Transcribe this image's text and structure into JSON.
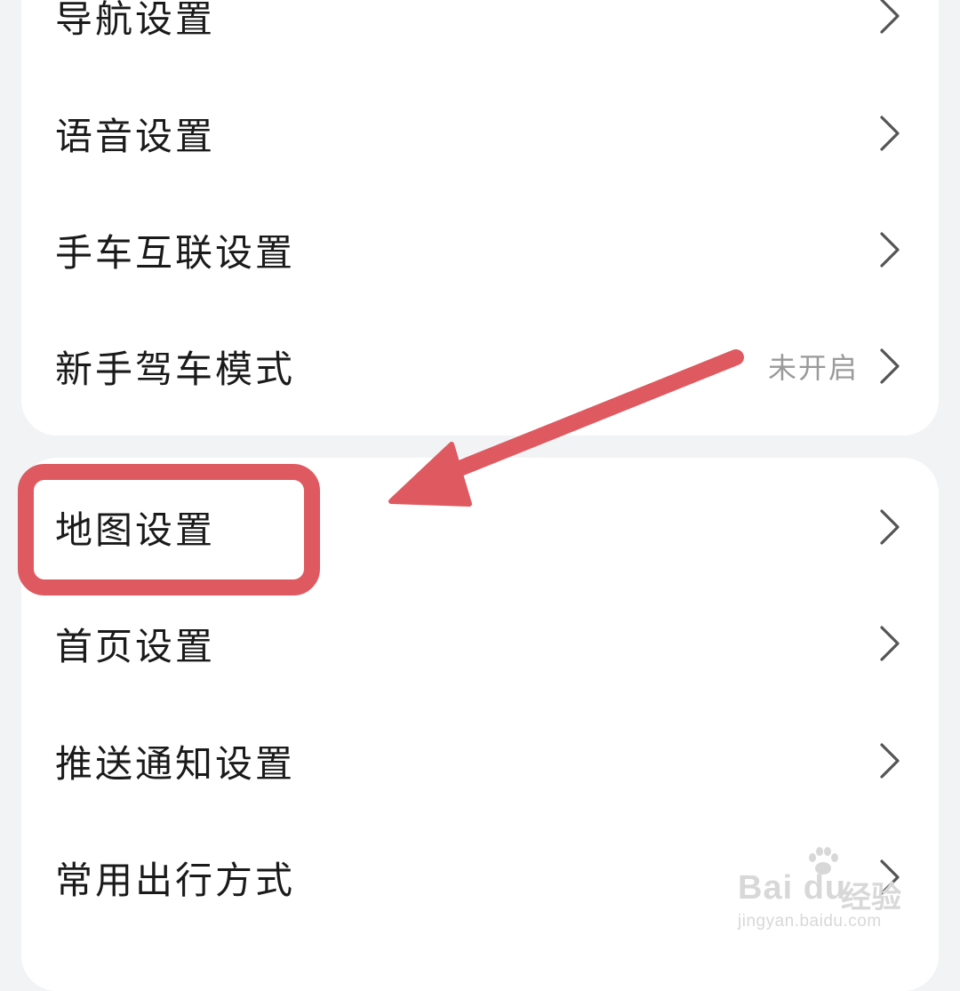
{
  "group1": {
    "items": [
      {
        "label": "导航设置",
        "value": ""
      },
      {
        "label": "语音设置",
        "value": ""
      },
      {
        "label": "手车互联设置",
        "value": ""
      },
      {
        "label": "新手驾车模式",
        "value": "未开启"
      }
    ]
  },
  "group2": {
    "items": [
      {
        "label": "地图设置",
        "value": ""
      },
      {
        "label": "首页设置",
        "value": ""
      },
      {
        "label": "推送通知设置",
        "value": ""
      },
      {
        "label": "常用出行方式",
        "value": ""
      }
    ]
  },
  "annotation": {
    "color": "#de5a60",
    "target": "地图设置"
  },
  "watermark": {
    "logo": "Bai du",
    "text": "经验",
    "url": "jingyan.baidu.com"
  },
  "icons": {
    "row_chevron": "chevron-right-icon"
  }
}
